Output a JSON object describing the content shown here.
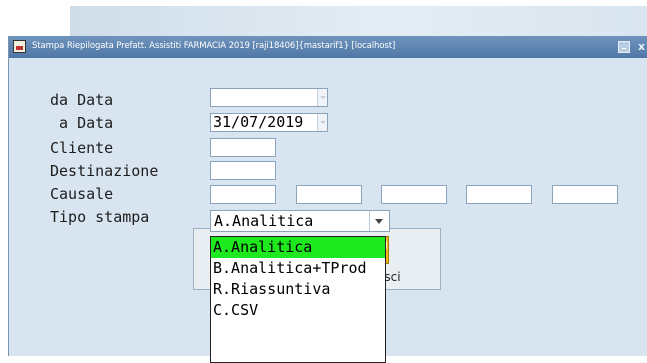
{
  "window": {
    "title": "Stampa Riepilogata Prefatt. Assistiti FARMACIA 2019 [raji18406]{mastarif1} [localhost]",
    "minimize_glyph": "_",
    "close_glyph": "x"
  },
  "form": {
    "labels": {
      "da_data": "da Data",
      "a_data": " a Data",
      "cliente": "Cliente",
      "destinazione": "Destinazione",
      "causale": "Causale",
      "tipo_stampa": "Tipo stampa"
    },
    "da_data_value": "",
    "a_data_value": "31/07/2019",
    "cliente_value": "",
    "destinazione_value": "",
    "causale_values": [
      "",
      "",
      "",
      "",
      ""
    ],
    "tipo_stampa_value": "A.Analitica"
  },
  "dropdown": {
    "options": [
      "A.Analitica",
      "B.Analitica+TProd",
      "R.Riassuntiva",
      "C.CSV"
    ],
    "highlighted": "A.Analitica"
  },
  "buttons": {
    "esci_label": ".Esci"
  },
  "colors": {
    "window_bg": "#d8e5f1",
    "titlebar": "#5a80ad",
    "highlight": "#1ee81e"
  },
  "icons": {
    "app": "app-icon",
    "minimize": "minimize-icon",
    "close": "close-icon",
    "exit": "door-exit-icon",
    "spinner": "spinner-icon",
    "combo_arrow": "chevron-down-icon"
  }
}
